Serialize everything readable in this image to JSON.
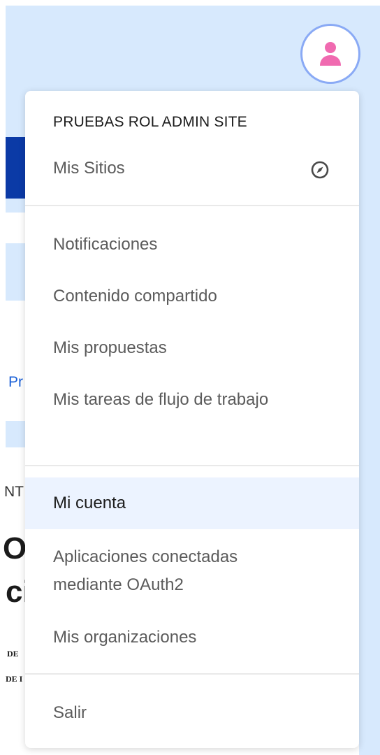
{
  "background": {
    "fragments": [
      "Pr",
      "NT",
      "Or",
      "ci",
      "DE",
      "DE I"
    ]
  },
  "header": {
    "avatar_icon": "user-icon"
  },
  "menu": {
    "site_name": "PRUEBAS ROL ADMIN SITE",
    "my_sites": {
      "label": "Mis Sitios",
      "icon": "compass-icon"
    },
    "items": [
      {
        "label": "Notificaciones"
      },
      {
        "label": "Contenido compartido"
      },
      {
        "label": "Mis propuestas"
      },
      {
        "label": "Mis tareas de flujo de trabajo"
      }
    ],
    "account_items": [
      {
        "label": "Mi cuenta",
        "active": true
      },
      {
        "label": "Aplicaciones conectadas mediante OAuth2"
      },
      {
        "label": "Mis organizaciones"
      }
    ],
    "logout": {
      "label": "Salir"
    }
  },
  "colors": {
    "page_bg": "#d7e9fd",
    "avatar_accent": "#f06ab0",
    "avatar_ring": "#8aaaf5",
    "active_item_bg": "#ecf3ff"
  }
}
